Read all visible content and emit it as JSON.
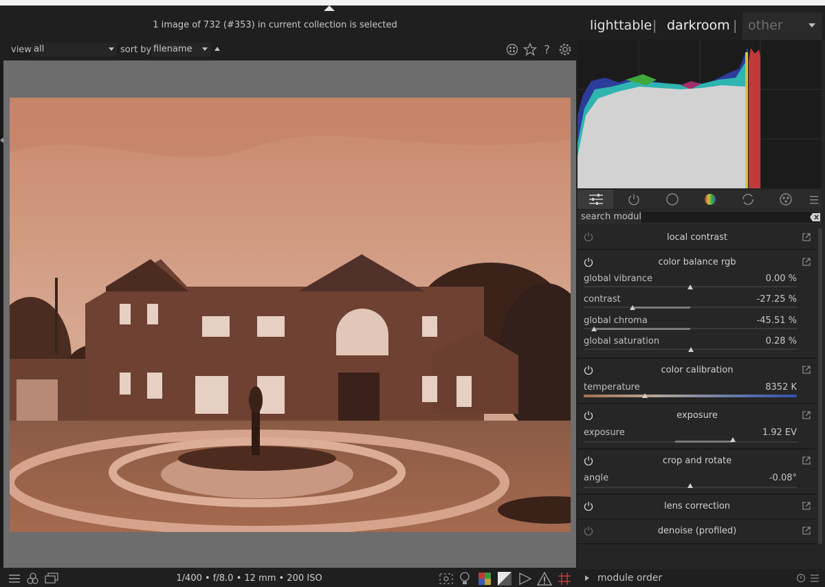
{
  "header": {
    "status": "1 image of 732 (#353) in current collection is selected"
  },
  "filterbar": {
    "view_label": "view",
    "view_value": "all",
    "sort_label": "sort by",
    "sort_value": "filename"
  },
  "viewtabs": {
    "lighttable": "lighttable",
    "darkroom": "darkroom",
    "other": "other",
    "sep": "|"
  },
  "search": {
    "placeholder": "search module"
  },
  "modules": {
    "local_contrast": {
      "title": "local contrast"
    },
    "color_balance": {
      "title": "color balance rgb",
      "sliders": [
        {
          "name": "global vibrance",
          "value": "0.00 %"
        },
        {
          "name": "contrast",
          "value": "-27.25 %"
        },
        {
          "name": "global chroma",
          "value": "-45.51 %"
        },
        {
          "name": "global saturation",
          "value": "0.28 %"
        }
      ]
    },
    "color_calibration": {
      "title": "color calibration",
      "slider_name": "temperature",
      "slider_value": "8352 K"
    },
    "exposure": {
      "title": "exposure",
      "slider_name": "exposure",
      "slider_value": "1.92 EV"
    },
    "crop": {
      "title": "crop and rotate",
      "slider_name": "angle",
      "slider_value": "-0.08°"
    },
    "lens": {
      "title": "lens correction"
    },
    "denoise": {
      "title": "denoise (profiled)"
    }
  },
  "bottombar": {
    "exposure_info": "1/400 • f/8.0 • 12 mm • 200 ISO"
  },
  "module_order": {
    "label": "module order"
  },
  "colors": {
    "accent_red": "#c03a3a",
    "temperature_blue": "#3050b0",
    "photo_tint": "#c8886a"
  }
}
